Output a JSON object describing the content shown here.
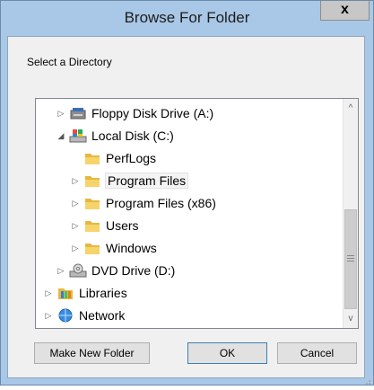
{
  "window": {
    "title": "Browse For Folder",
    "close_glyph": "x"
  },
  "prompt": "Select a Directory",
  "tree": {
    "items": [
      {
        "label": "Floppy Disk Drive (A:)",
        "icon": "floppy-drive-icon",
        "expander": "▷"
      },
      {
        "label": "Local Disk (C:)",
        "icon": "local-disk-icon",
        "expander": "◢"
      },
      {
        "label": "PerfLogs",
        "icon": "folder-icon",
        "expander": ""
      },
      {
        "label": "Program Files",
        "icon": "folder-icon",
        "expander": "▷",
        "selected": true
      },
      {
        "label": "Program Files (x86)",
        "icon": "folder-icon",
        "expander": "▷"
      },
      {
        "label": "Users",
        "icon": "folder-icon",
        "expander": "▷"
      },
      {
        "label": "Windows",
        "icon": "folder-icon",
        "expander": "▷"
      },
      {
        "label": "DVD Drive (D:)",
        "icon": "dvd-drive-icon",
        "expander": "▷"
      },
      {
        "label": "Libraries",
        "icon": "libraries-icon",
        "expander": "▷"
      },
      {
        "label": "Network",
        "icon": "network-icon",
        "expander": "▷"
      }
    ],
    "scroll_up_glyph": "^",
    "scroll_down_glyph": "v"
  },
  "buttons": {
    "new_folder": "Make New Folder",
    "ok": "OK",
    "cancel": "Cancel"
  },
  "colors": {
    "title_bar": "#a9c7e6",
    "folder_yellow": "#f2c94c",
    "selection_border": "#3c7fb1"
  }
}
